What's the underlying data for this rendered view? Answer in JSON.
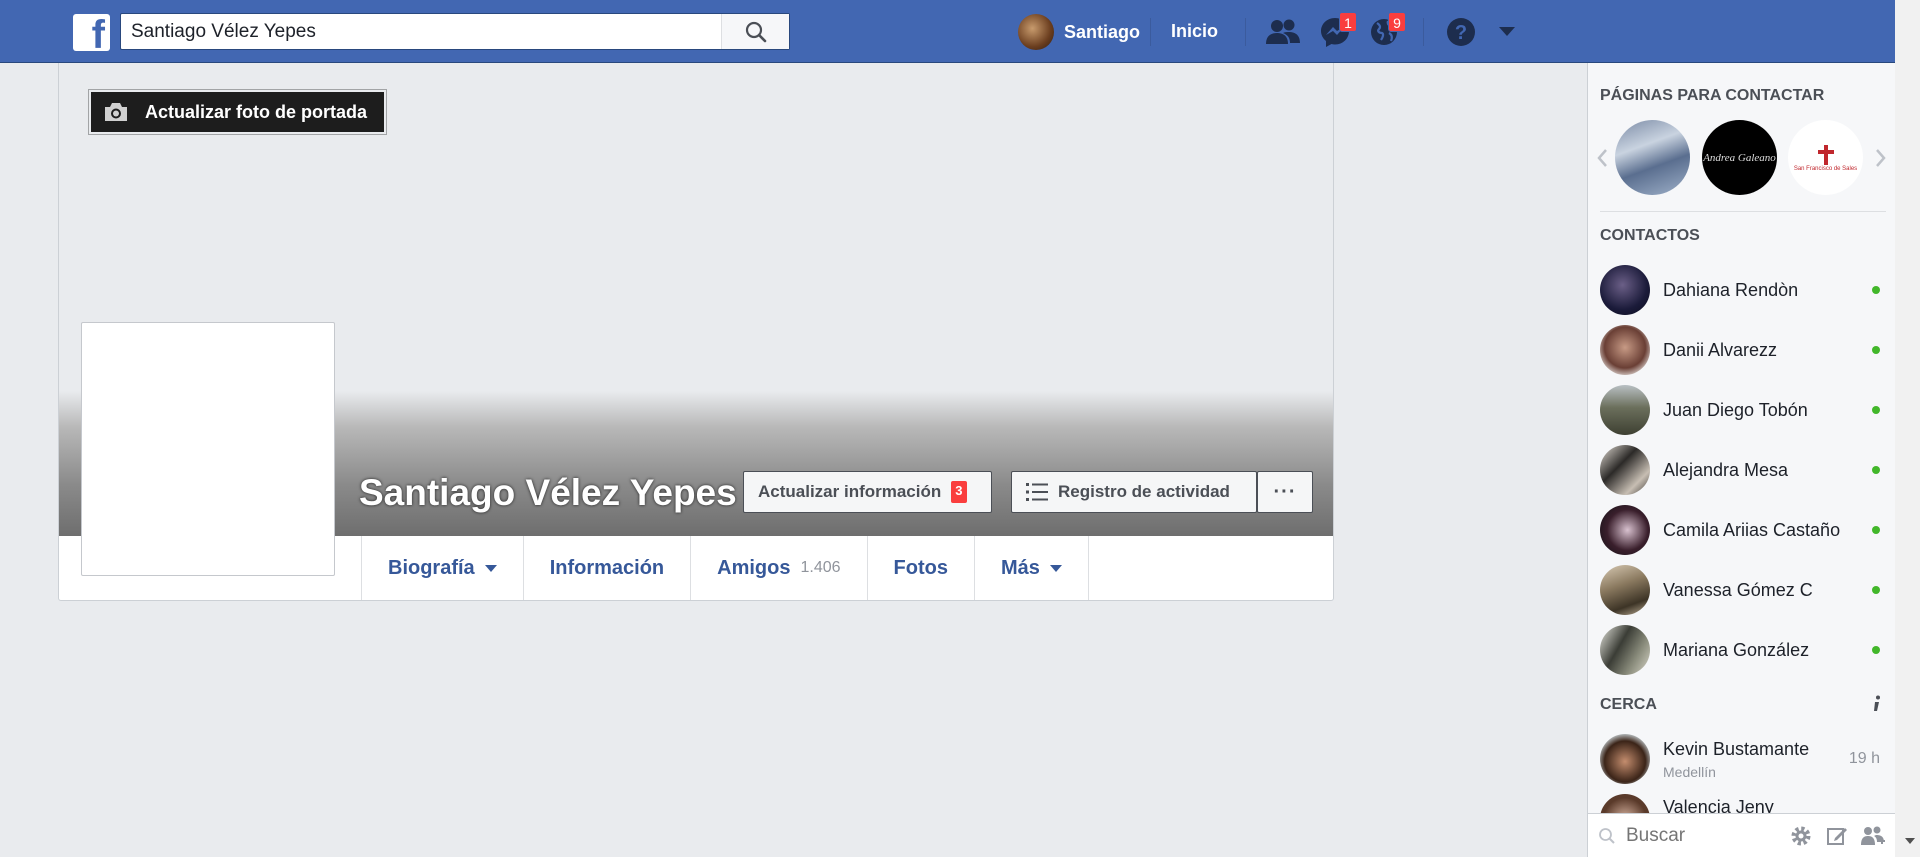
{
  "topbar": {
    "logo": "f",
    "search_value": "Santiago Vélez Yepes",
    "user_name": "Santiago",
    "home_label": "Inicio",
    "messages_badge": "1",
    "notifications_badge": "9",
    "brand_color": "#4267b2"
  },
  "cover": {
    "update_cover_label": "Actualizar foto de portada",
    "profile_name": "Santiago Vélez Yepes",
    "update_info_label": "Actualizar información",
    "update_info_badge": "3",
    "activity_log_label": "Registro de actividad",
    "more_dots": "···"
  },
  "profile_tabs": {
    "timeline": "Biografía",
    "about": "Información",
    "friends": "Amigos",
    "friends_count": "1.406",
    "photos": "Fotos",
    "more": "Más"
  },
  "sidebar": {
    "pages_heading": "PÁGINAS PARA CONTACTAR",
    "pages": [
      {
        "caption": ""
      },
      {
        "caption": "Andrea Galeano"
      },
      {
        "caption": "San Francisco de Sales"
      }
    ],
    "contacts_heading": "CONTACTOS",
    "contacts": [
      {
        "name": "Dahiana Rendòn"
      },
      {
        "name": "Danii Alvarezz"
      },
      {
        "name": "Juan Diego Tobón"
      },
      {
        "name": "Alejandra Mesa"
      },
      {
        "name": "Camila Ariias Castaño"
      },
      {
        "name": "Vanessa Gómez C"
      },
      {
        "name": "Mariana González"
      }
    ],
    "nearby_heading": "CERCA",
    "nearby": [
      {
        "name": "Kevin Bustamante",
        "location": "Medellín",
        "time": "19 h"
      },
      {
        "name": "Valencia Jeny"
      }
    ],
    "search_placeholder": "Buscar"
  }
}
